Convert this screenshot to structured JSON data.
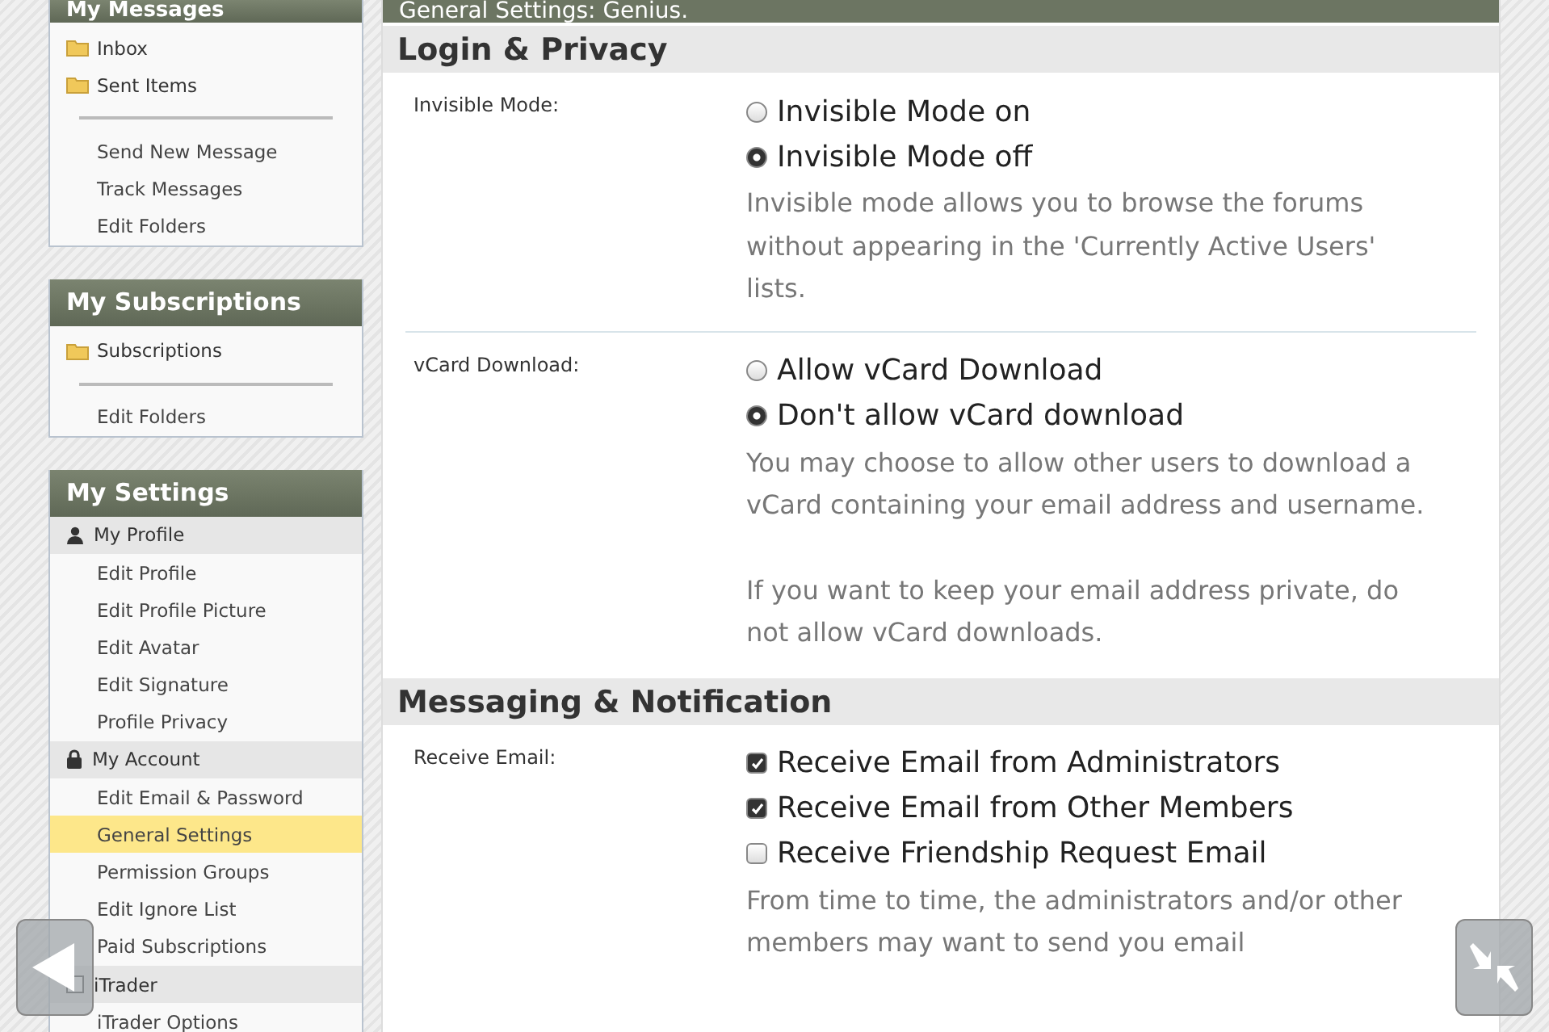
{
  "sidebar": [
    {
      "title": "My Messages",
      "items": [
        {
          "kind": "folder",
          "label": "Inbox",
          "selected": false
        },
        {
          "kind": "folder",
          "label": "Sent Items",
          "selected": false
        },
        {
          "kind": "divider"
        },
        {
          "kind": "link",
          "label": "Send New Message",
          "selected": false
        },
        {
          "kind": "link",
          "label": "Track Messages",
          "selected": false
        },
        {
          "kind": "link",
          "label": "Edit Folders",
          "selected": false
        }
      ]
    },
    {
      "title": "My Subscriptions",
      "items": [
        {
          "kind": "folder",
          "label": "Subscriptions",
          "selected": false
        },
        {
          "kind": "divider"
        },
        {
          "kind": "link",
          "label": "Edit Folders",
          "selected": false
        }
      ]
    },
    {
      "title": "My Settings",
      "items": [
        {
          "kind": "heading",
          "label": "My Profile"
        },
        {
          "kind": "link",
          "label": "Edit Profile",
          "selected": false
        },
        {
          "kind": "link",
          "label": "Edit Profile Picture",
          "selected": false
        },
        {
          "kind": "link",
          "label": "Edit Avatar",
          "selected": false
        },
        {
          "kind": "link",
          "label": "Edit Signature",
          "selected": false
        },
        {
          "kind": "link",
          "label": "Profile Privacy",
          "selected": false
        },
        {
          "kind": "heading",
          "label": "My Account"
        },
        {
          "kind": "link",
          "label": "Edit Email & Password",
          "selected": false
        },
        {
          "kind": "link",
          "label": "General Settings",
          "selected": true
        },
        {
          "kind": "link",
          "label": "Permission Groups",
          "selected": false
        },
        {
          "kind": "link",
          "label": "Edit Ignore List",
          "selected": false
        },
        {
          "kind": "link",
          "label": "Paid Subscriptions",
          "selected": false
        },
        {
          "kind": "heading",
          "label": "iTrader"
        },
        {
          "kind": "link",
          "label": "iTrader Options",
          "selected": false
        }
      ]
    }
  ],
  "content": {
    "title": "General Settings: Genius.",
    "sections": [
      {
        "title": "Login & Privacy",
        "rows": [
          {
            "label": "Invisible Mode:",
            "options": [
              {
                "kind": "radio",
                "label": "Invisible Mode on",
                "selected": false
              },
              {
                "kind": "radio",
                "label": "Invisible Mode off",
                "selected": true
              }
            ],
            "description": [
              "Invisible mode allows you to browse the forums without appearing in the 'Currently Active Users' lists."
            ]
          },
          {
            "label": "vCard Download:",
            "options": [
              {
                "kind": "radio",
                "label": "Allow vCard Download",
                "selected": false
              },
              {
                "kind": "radio",
                "label": "Don't allow vCard download",
                "selected": true
              }
            ],
            "description": [
              "You may choose to allow other users to download a vCard containing your email address and username.",
              "If you want to keep your email address private, do not allow vCard downloads."
            ]
          }
        ]
      },
      {
        "title": "Messaging & Notification",
        "rows": [
          {
            "label": "Receive Email:",
            "options": [
              {
                "kind": "checkbox",
                "label": "Receive Email from Administrators",
                "checked": true
              },
              {
                "kind": "checkbox",
                "label": "Receive Email from Other Members",
                "checked": true
              },
              {
                "kind": "checkbox",
                "label": "Receive Friendship Request Email",
                "checked": false
              }
            ],
            "description": [
              "From time to time, the administrators and/or other members may want to send you email"
            ]
          }
        ]
      }
    ]
  }
}
